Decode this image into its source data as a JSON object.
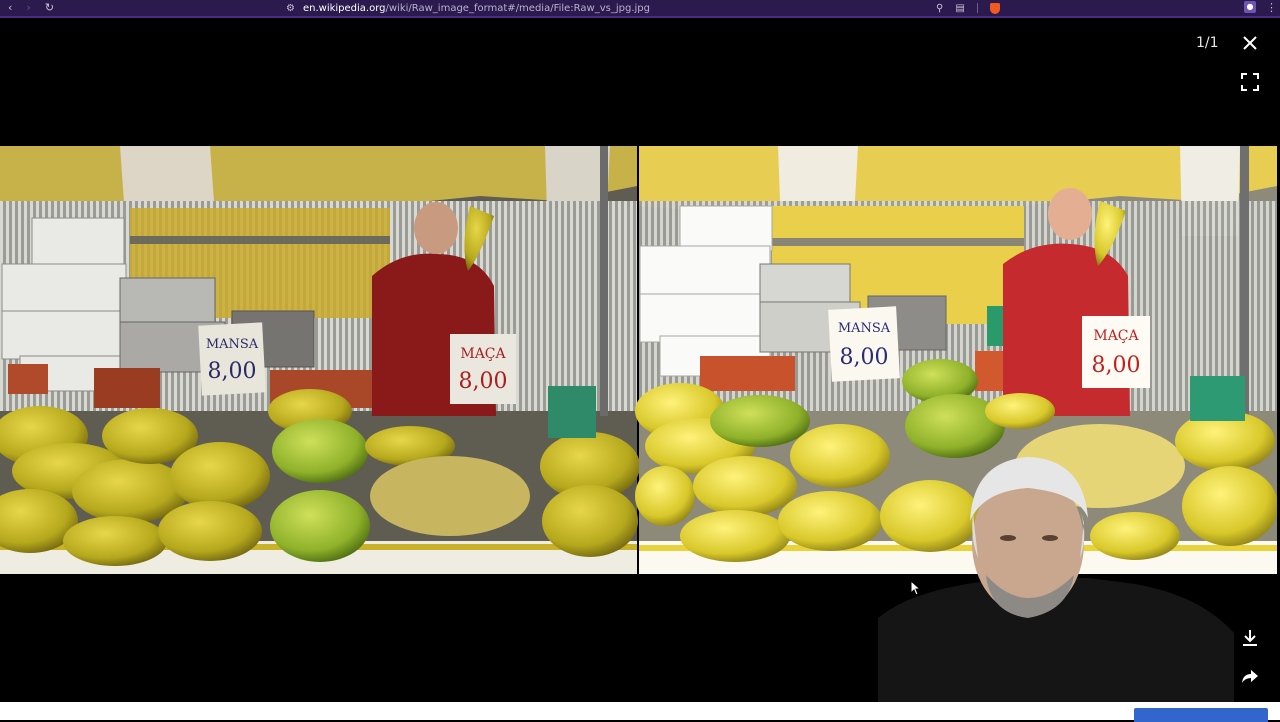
{
  "browser": {
    "back_icon": "chevron-left",
    "forward_icon": "chevron-right",
    "reload_icon": "reload",
    "url_host": "en.wikipedia.org",
    "url_path": "/wiki/Raw_image_format#/media/File:Raw_vs_jpg.jpg",
    "zoom_icon": "zoom-icon",
    "reader_icon": "reader-icon",
    "shield_icon": "brave-shield-icon"
  },
  "viewer": {
    "counter": "1/1",
    "close_icon": "close-icon",
    "fullscreen_icon": "fullscreen-icon",
    "download_icon": "download-icon",
    "share_icon": "share-icon"
  },
  "image": {
    "left_sign_1": "MANSA",
    "left_sign_1_price": "8,00",
    "left_sign_2": "MAÇA",
    "left_sign_2_price": "8,00",
    "right_sign_1": "MANSA",
    "right_sign_1_price": "8,00",
    "right_sign_2": "MAÇA",
    "right_sign_2_price": "8,00"
  },
  "colors": {
    "chrome": "#2b1a4d",
    "accent": "#3366cc",
    "awning": "#e1c84a"
  }
}
